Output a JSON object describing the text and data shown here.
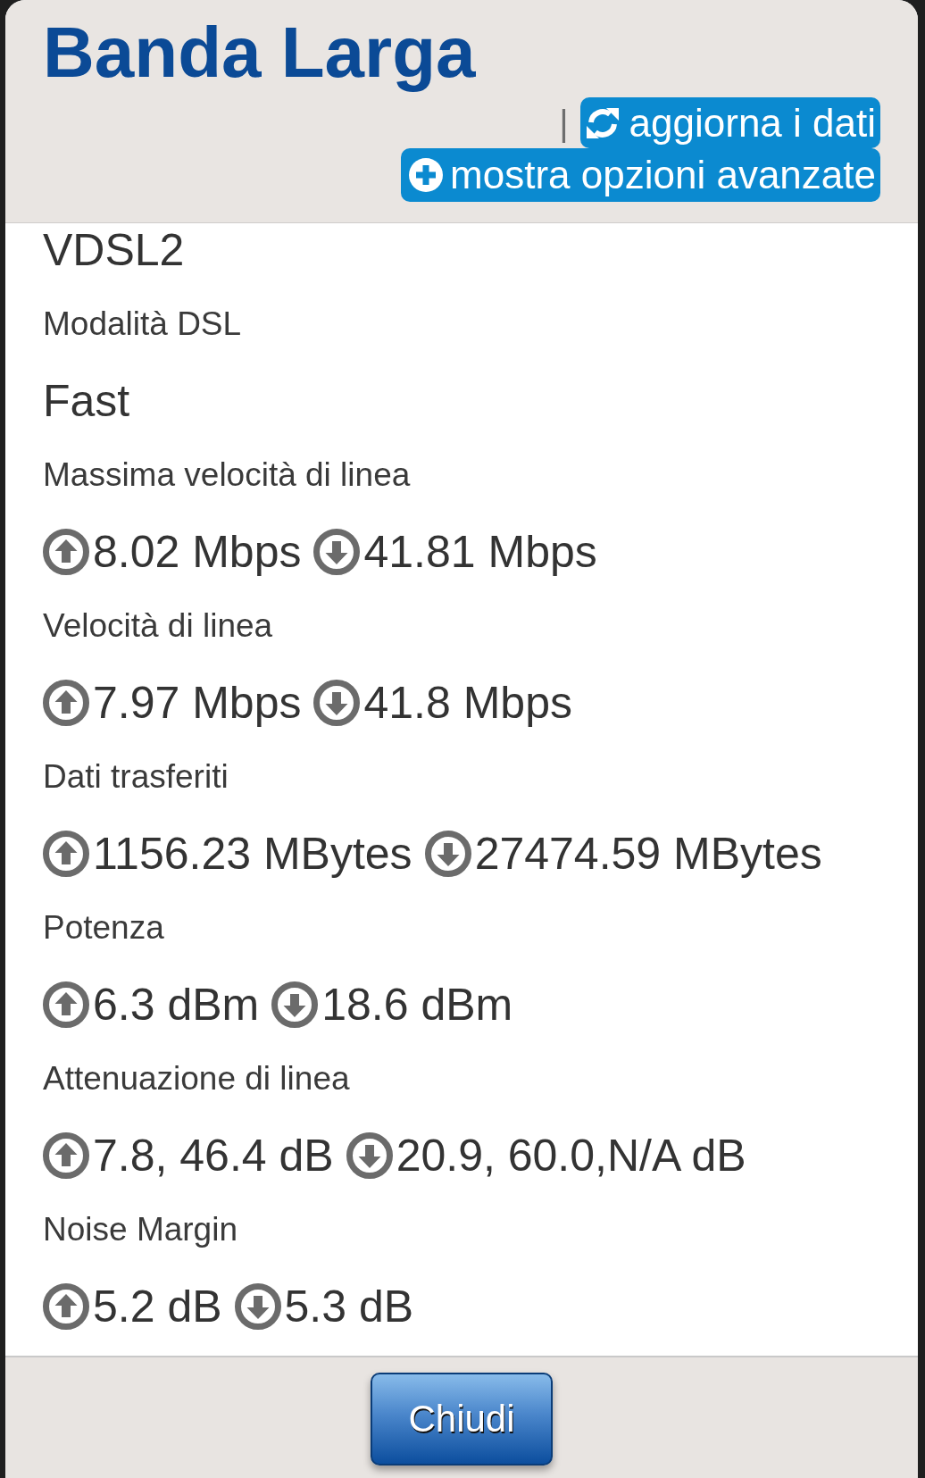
{
  "title": "Banda Larga",
  "toolbar": {
    "separator": "|",
    "actions": [
      {
        "kind": "refresh",
        "label": "aggiorna i dati"
      },
      {
        "kind": "plus",
        "label": "mostra opzioni avanzate"
      }
    ]
  },
  "fields": [
    {
      "kind": "text",
      "value": "VDSL2"
    },
    {
      "kind": "text",
      "label": "Modalità DSL",
      "value": "Fast"
    },
    {
      "kind": "updown",
      "label": "Massima velocità di linea",
      "up": "8.02 Mbps",
      "down": "41.81 Mbps"
    },
    {
      "kind": "updown",
      "label": "Velocità di linea",
      "up": "7.97 Mbps",
      "down": "41.8 Mbps"
    },
    {
      "kind": "updown",
      "label": "Dati trasferiti",
      "up": "1156.23 MBytes",
      "down": "27474.59 MBytes"
    },
    {
      "kind": "updown",
      "label": "Potenza",
      "up": "6.3 dBm",
      "down": "18.6 dBm"
    },
    {
      "kind": "updown",
      "label": "Attenuazione di linea",
      "up": "7.8, 46.4 dB",
      "down": "20.9, 60.0,N/A dB"
    },
    {
      "kind": "updown",
      "label": "Noise Margin",
      "up": "5.2 dB",
      "down": "5.3 dB"
    }
  ],
  "footer": {
    "button": "Chiudi"
  }
}
